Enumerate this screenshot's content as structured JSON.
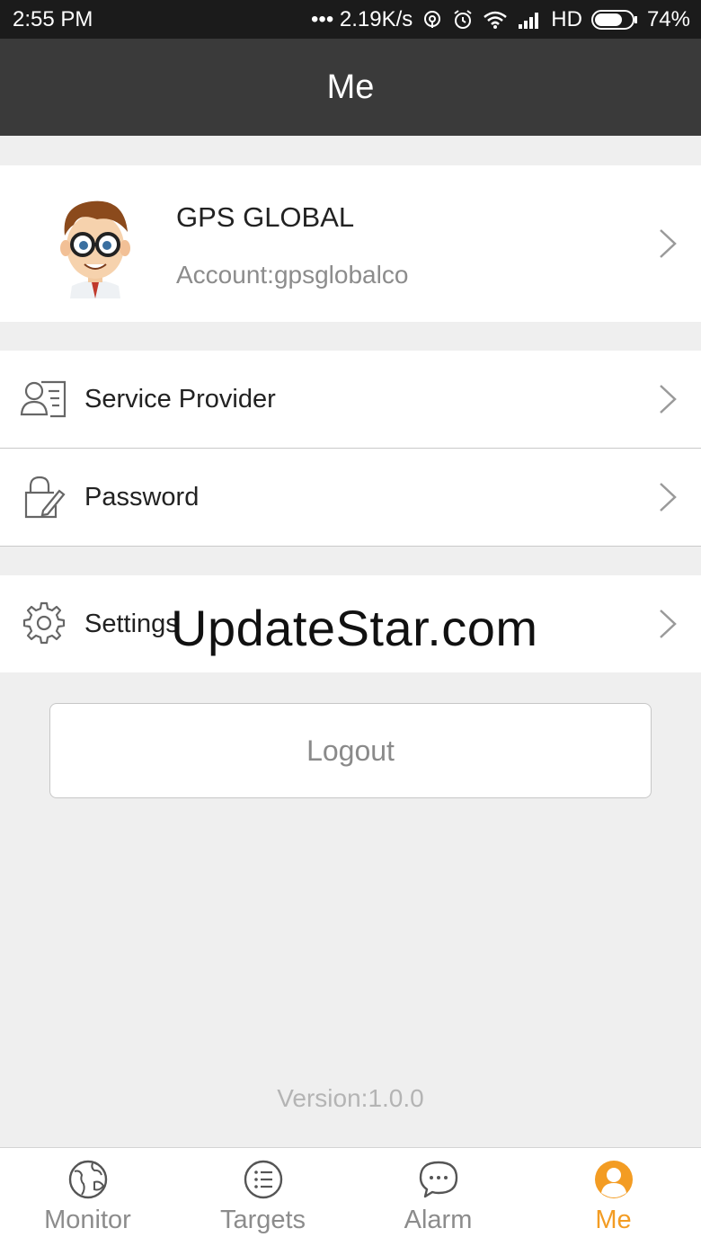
{
  "status_bar": {
    "time": "2:55 PM",
    "network_speed": "••• 2.19K/s",
    "network_type": "HD",
    "battery": "74%",
    "battery_level": 0.74
  },
  "header": {
    "title": "Me"
  },
  "profile": {
    "name": "GPS GLOBAL",
    "account": "Account:gpsglobalco",
    "avatar_icon": "cartoon-avatar"
  },
  "menu": [
    {
      "label": "Service Provider",
      "icon": "contact-card-icon"
    },
    {
      "label": "Password",
      "icon": "lock-edit-icon"
    },
    {
      "label": "Settings",
      "icon": "gear-icon"
    }
  ],
  "watermark": "UpdateStar.com",
  "logout_label": "Logout",
  "version": "Version:1.0.0",
  "tabs": [
    {
      "label": "Monitor",
      "icon": "globe-icon",
      "active": false
    },
    {
      "label": "Targets",
      "icon": "list-icon",
      "active": false
    },
    {
      "label": "Alarm",
      "icon": "chat-bubble-icon",
      "active": false
    },
    {
      "label": "Me",
      "icon": "person-icon",
      "active": true
    }
  ],
  "colors": {
    "accent": "#f39c23",
    "header_bg": "#3a3a3a",
    "status_bg": "#1b1b1b",
    "page_bg": "#efefef"
  }
}
